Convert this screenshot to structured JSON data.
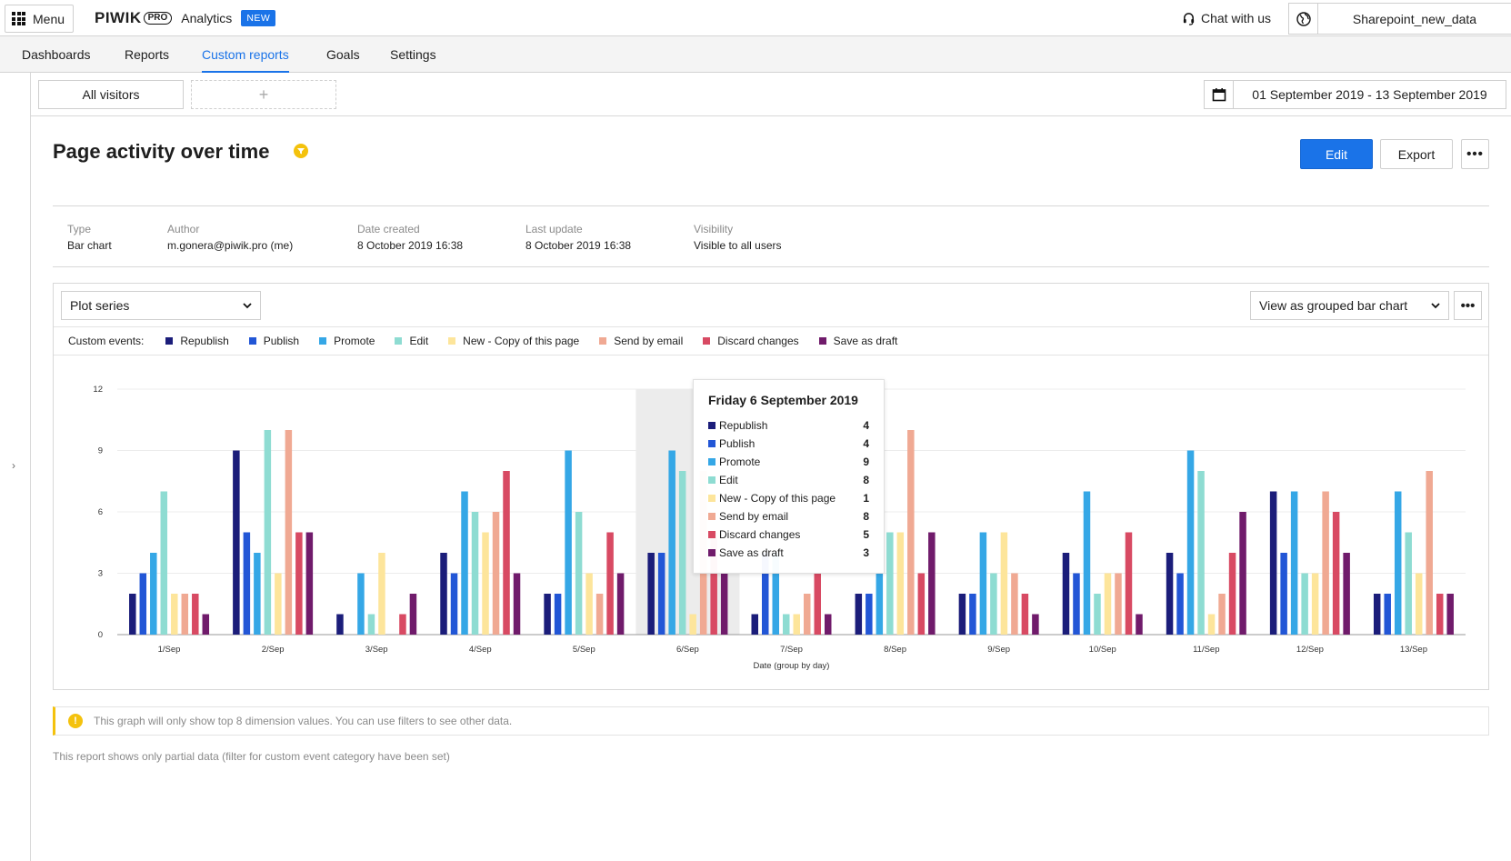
{
  "topbar": {
    "menu_label": "Menu",
    "logo_text": "PIWIK",
    "logo_pro": "PRO",
    "product": "Analytics",
    "new_badge": "NEW",
    "chat_label": "Chat with us",
    "site_name": "Sharepoint_new_data"
  },
  "nav": {
    "tabs": [
      {
        "label": "Dashboards",
        "active": false
      },
      {
        "label": "Reports",
        "active": false
      },
      {
        "label": "Custom reports",
        "active": true
      },
      {
        "label": "Goals",
        "active": false
      },
      {
        "label": "Settings",
        "active": false
      }
    ]
  },
  "segments": {
    "current": "All visitors",
    "add_symbol": "+",
    "date_range": "01 September 2019 - 13 September 2019"
  },
  "report": {
    "title": "Page activity over time",
    "edit_label": "Edit",
    "export_label": "Export",
    "more_label": "•••",
    "meta": [
      {
        "label": "Type",
        "value": "Bar chart"
      },
      {
        "label": "Author",
        "value": "m.gonera@piwik.pro (me)"
      },
      {
        "label": "Date created",
        "value": "8 October 2019 16:38"
      },
      {
        "label": "Last update",
        "value": "8 October 2019 16:38"
      },
      {
        "label": "Visibility",
        "value": "Visible to all users"
      }
    ]
  },
  "chart_controls": {
    "plot_label": "Plot series",
    "view_label": "View as grouped bar chart",
    "legend_title": "Custom events:"
  },
  "colors": {
    "Republish": "#1b1d7a",
    "Publish": "#2256d6",
    "Promote": "#35a7e6",
    "Edit": "#8edcd2",
    "New - Copy of this page": "#fde59b",
    "Send by email": "#f0a993",
    "Discard changes": "#d84a63",
    "Save as draft": "#701b6b",
    "accent": "#1a73e8",
    "warning": "#f4c20d"
  },
  "chart_data": {
    "type": "bar",
    "xlabel": "Date (group by day)",
    "ylabel": "",
    "ylim": [
      0,
      12
    ],
    "yticks": [
      0,
      3,
      6,
      9,
      12
    ],
    "grid": true,
    "highlighted_category": "6/Sep",
    "categories": [
      "1/Sep",
      "2/Sep",
      "3/Sep",
      "4/Sep",
      "5/Sep",
      "6/Sep",
      "7/Sep",
      "8/Sep",
      "9/Sep",
      "10/Sep",
      "11/Sep",
      "12/Sep",
      "13/Sep"
    ],
    "series": [
      {
        "name": "Republish",
        "values": [
          2,
          9,
          1,
          4,
          2,
          4,
          1,
          2,
          2,
          4,
          4,
          7,
          2
        ]
      },
      {
        "name": "Publish",
        "values": [
          3,
          5,
          0,
          3,
          2,
          4,
          4,
          2,
          2,
          3,
          3,
          4,
          2
        ]
      },
      {
        "name": "Promote",
        "values": [
          4,
          4,
          3,
          7,
          9,
          9,
          4,
          3,
          5,
          7,
          9,
          7,
          7
        ]
      },
      {
        "name": "Edit",
        "values": [
          7,
          10,
          1,
          6,
          6,
          8,
          1,
          5,
          3,
          2,
          8,
          3,
          5
        ]
      },
      {
        "name": "New - Copy of this page",
        "values": [
          2,
          3,
          4,
          5,
          3,
          1,
          1,
          5,
          5,
          3,
          1,
          3,
          3
        ]
      },
      {
        "name": "Send by email",
        "values": [
          2,
          10,
          0,
          6,
          2,
          8,
          2,
          10,
          3,
          3,
          2,
          7,
          8
        ]
      },
      {
        "name": "Discard changes",
        "values": [
          2,
          5,
          1,
          8,
          5,
          5,
          3,
          3,
          2,
          5,
          4,
          6,
          2
        ]
      },
      {
        "name": "Save as draft",
        "values": [
          1,
          5,
          2,
          3,
          3,
          3,
          1,
          5,
          1,
          1,
          6,
          4,
          2
        ]
      }
    ]
  },
  "tooltip": {
    "title": "Friday 6 September 2019",
    "rows": [
      {
        "name": "Republish",
        "value": "4"
      },
      {
        "name": "Publish",
        "value": "4"
      },
      {
        "name": "Promote",
        "value": "9"
      },
      {
        "name": "Edit",
        "value": "8"
      },
      {
        "name": "New - Copy of this page",
        "value": "1"
      },
      {
        "name": "Send by email",
        "value": "8"
      },
      {
        "name": "Discard changes",
        "value": "5"
      },
      {
        "name": "Save as draft",
        "value": "3"
      }
    ]
  },
  "notice": "This graph will only show top 8 dimension values. You can use filters to see other data.",
  "partial_note": "This report shows only partial data (filter for custom event category have been set)"
}
